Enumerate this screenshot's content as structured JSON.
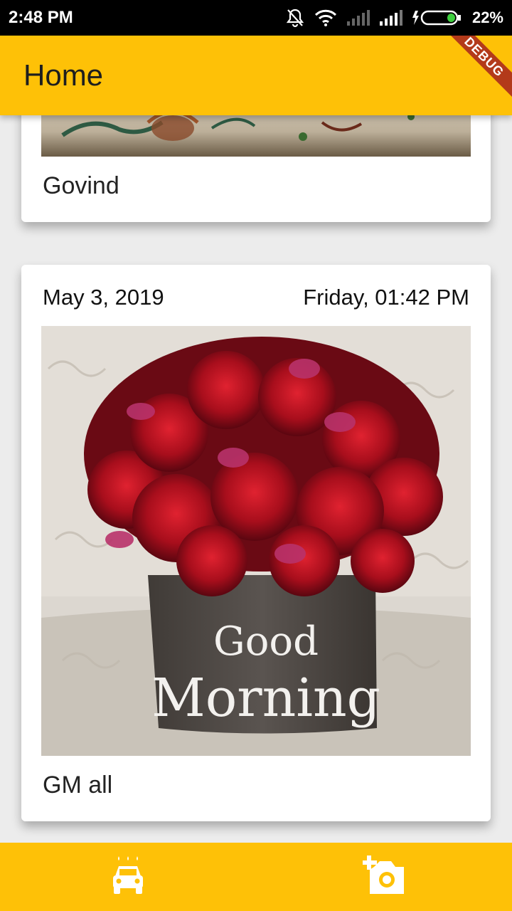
{
  "status_bar": {
    "time": "2:48 PM",
    "battery": "22%"
  },
  "app_bar": {
    "title": "Home",
    "debug_banner": "DEBUG"
  },
  "posts": [
    {
      "caption": "Govind"
    },
    {
      "date": "May 3, 2019",
      "day_time": "Friday, 01:42 PM",
      "image_text_line1": "Good",
      "image_text_line2": "Morning",
      "caption": "GM all"
    }
  ],
  "bottom_nav": [
    {
      "icon": "car-wash-icon"
    },
    {
      "icon": "add-photo-icon"
    }
  ],
  "colors": {
    "accent": "#fec107",
    "status_bar": "#000000",
    "card": "#ffffff",
    "debug_banner": "#b33a1a"
  }
}
